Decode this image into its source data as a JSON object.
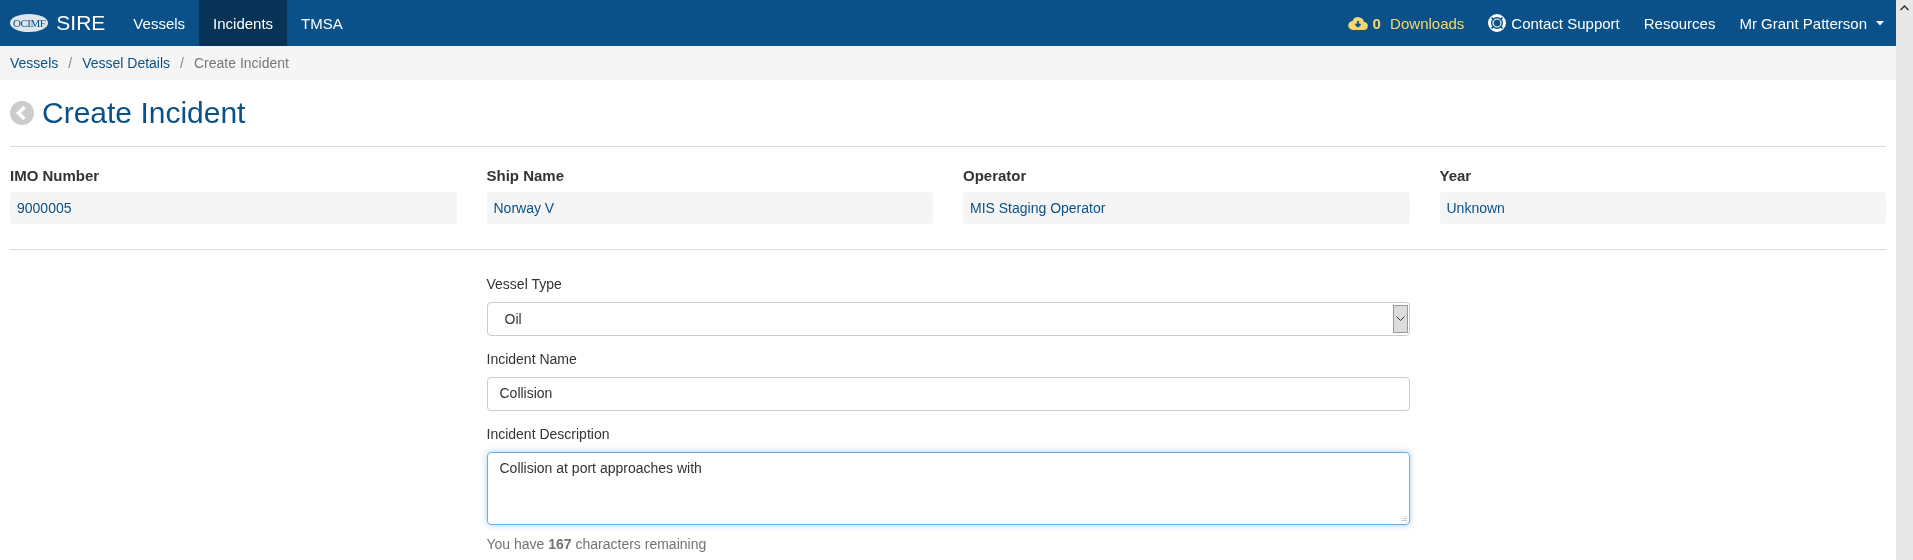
{
  "navbar": {
    "logo": "OCIMF",
    "brand": "SIRE",
    "links": [
      {
        "label": "Vessels",
        "selected": false
      },
      {
        "label": "Incidents",
        "selected": true
      },
      {
        "label": "TMSA",
        "selected": false
      }
    ],
    "downloads": {
      "count": "0",
      "label": "Downloads"
    },
    "support": "Contact Support",
    "resources": "Resources",
    "user": "Mr Grant Patterson"
  },
  "breadcrumb": [
    {
      "label": "Vessels",
      "kind": "link"
    },
    {
      "label": "Vessel Details",
      "kind": "link",
      "separator": "/"
    },
    {
      "label": "Create Incident",
      "kind": "current",
      "separator": "/"
    }
  ],
  "page_title": "Create Incident",
  "vessel_info": [
    {
      "label": "IMO Number",
      "value": "9000005"
    },
    {
      "label": "Ship Name",
      "value": "Norway V"
    },
    {
      "label": "Operator",
      "value": "MIS Staging Operator"
    },
    {
      "label": "Year",
      "value": "Unknown"
    }
  ],
  "form": [
    {
      "kind": "select",
      "label": "Vessel Type",
      "value": "Oil",
      "focused": false
    },
    {
      "kind": "input",
      "label": "Incident Name",
      "value": "Collision",
      "focused": false
    },
    {
      "kind": "textarea",
      "label": "Incident Description",
      "value": "Collision at port approaches with",
      "focused": true
    }
  ],
  "remaining": "You have **167** characters remaining"
}
